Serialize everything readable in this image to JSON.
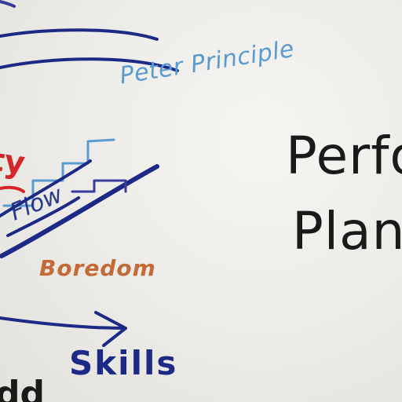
{
  "whiteboard": {
    "peter_principle": "Peter Principle",
    "boredom": "Boredom",
    "skills": "Skills",
    "flow_fragment": "Flow",
    "anxiety_fragment": "ty",
    "heading_line1_fragment": "Perfo",
    "heading_line2_fragment": "Plan",
    "bottom_fragment": "dd"
  },
  "colors": {
    "board": "#ecebe7",
    "navy_marker": "#1c2a86",
    "light_blue_marker": "#5a9bd0",
    "orange_marker": "#c46a36",
    "red_marker": "#d6262a",
    "black_marker": "#1a1a1a"
  }
}
